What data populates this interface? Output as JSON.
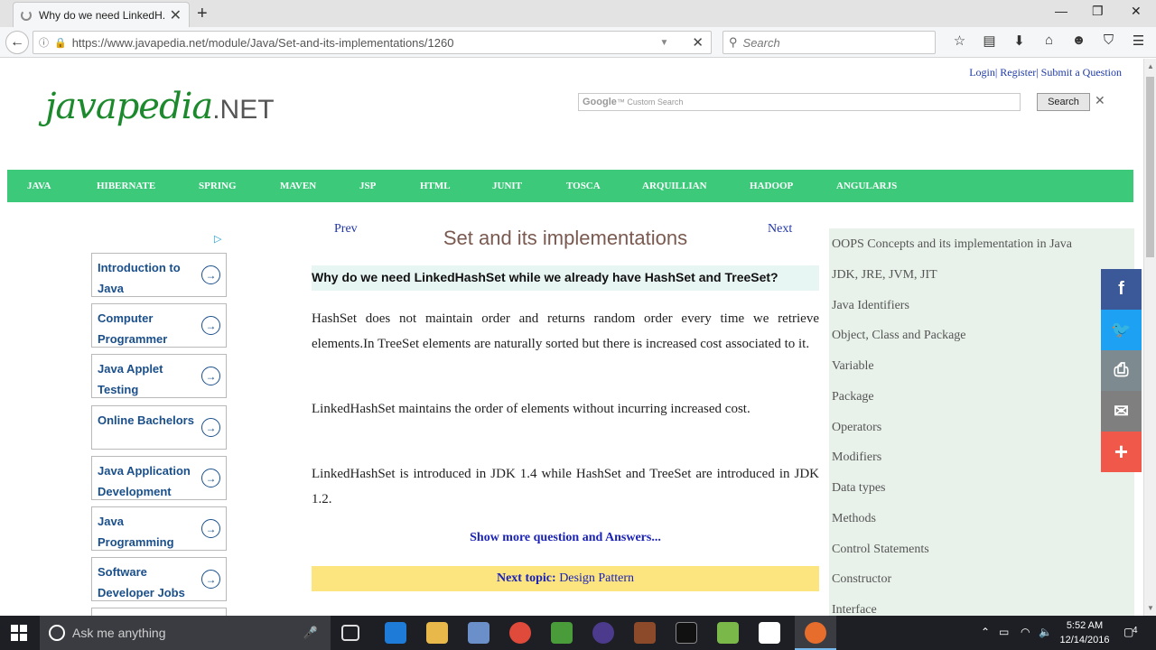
{
  "browser": {
    "tab_title": "Why do we need LinkedH...",
    "url": "https://www.javapedia.net/module/Java/Set-and-its-implementations/1260",
    "search_placeholder": "Search"
  },
  "header": {
    "links": "Login| Register| Submit a Question",
    "logo_main": "javapedia",
    "logo_suffix": ".NET",
    "google_label": "Google",
    "google_placeholder": "Custom Search",
    "search_button": "Search"
  },
  "menu": [
    "JAVA",
    "HIBERNATE",
    "SPRING",
    "MAVEN",
    "JSP",
    "HTML",
    "JUNIT",
    "TOSCA",
    "ARQUILLIAN",
    "HADOOP",
    "ANGULARJS"
  ],
  "ads": [
    "Introduction to Java",
    "Computer Programmer",
    "Java Applet Testing",
    "Online Bachelors",
    "Java Application Development",
    "Java Programming",
    "Software Developer Jobs"
  ],
  "content": {
    "prev": "Prev",
    "next": "Next",
    "title": "Set and its implementations",
    "question": "Why do we need LinkedHashSet while we already have HashSet and TreeSet?",
    "para1": "HashSet does not maintain order and returns random order every time we retrieve elements.In TreeSet elements are naturally sorted but there is increased cost associated to it.",
    "para2": "LinkedHashSet maintains the order of elements without incurring increased cost.",
    "para3": "LinkedHashSet is introduced in JDK 1.4 while HashSet and TreeSet are introduced in JDK 1.2.",
    "show_more": "Show more question and Answers...",
    "next_topic_label": "Next topic:",
    "next_topic": "Design Pattern"
  },
  "sidebar": [
    "OOPS Concepts and its implementation in Java",
    "JDK, JRE, JVM, JIT",
    "Java Identifiers",
    "Object, Class and Package",
    "Variable",
    "Package",
    "Operators",
    "Modifiers",
    "Data types",
    "Methods",
    "Control Statements",
    "Constructor",
    "Interface"
  ],
  "share": [
    {
      "icon": "facebook-icon",
      "glyph": "f",
      "color": "#3b5998"
    },
    {
      "icon": "twitter-icon",
      "glyph": "🐦",
      "color": "#1da1f2"
    },
    {
      "icon": "print-icon",
      "glyph": "⎙",
      "color": "#7d8a90"
    },
    {
      "icon": "email-icon",
      "glyph": "✉",
      "color": "#7f7f7f"
    },
    {
      "icon": "plus-icon",
      "glyph": "+",
      "color": "#f0594a"
    }
  ],
  "taskbar": {
    "cortana": "Ask me anything",
    "time": "5:52 AM",
    "date": "12/14/2016",
    "notifications": "4"
  }
}
